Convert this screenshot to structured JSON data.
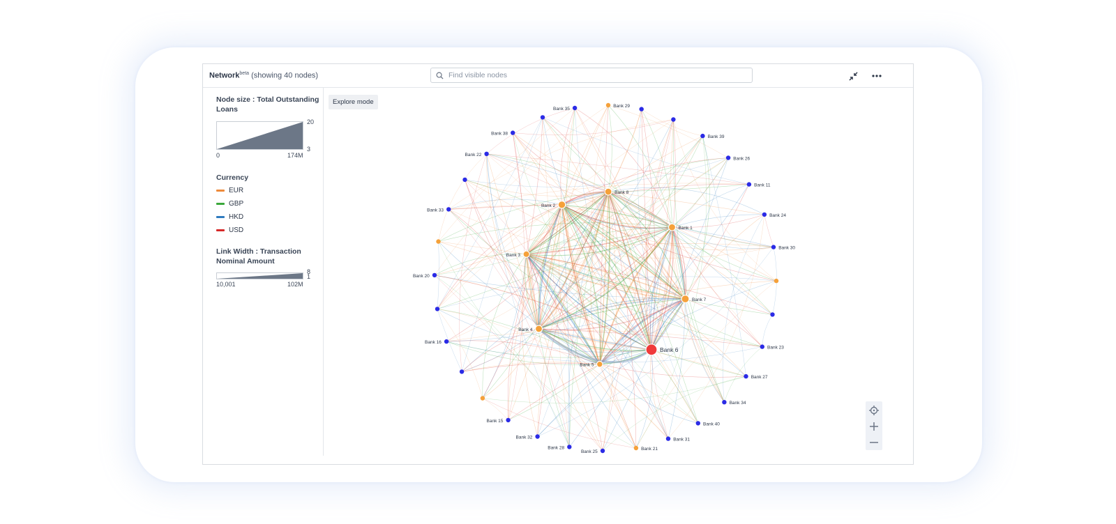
{
  "header": {
    "title": "Network",
    "beta": "beta",
    "subtitle": "(showing 40 nodes)",
    "search_placeholder": "Find visible nodes"
  },
  "sidebar": {
    "node_size_title": "Node size : Total Outstanding Loans",
    "node_size_min": "0",
    "node_size_max": "174M",
    "node_size_low": "3",
    "node_size_high": "20",
    "currency_title": "Currency",
    "currencies": [
      {
        "label": "EUR",
        "color": "#ee8a3a"
      },
      {
        "label": "GBP",
        "color": "#3aa83a"
      },
      {
        "label": "HKD",
        "color": "#2f7bbf"
      },
      {
        "label": "USD",
        "color": "#d62828"
      }
    ],
    "link_width_title": "Link Width : Transaction Nominal Amount",
    "link_min": "10,001",
    "link_max": "102M",
    "link_low": "1",
    "link_high": "8"
  },
  "explore_label": "Explore mode",
  "icons": {
    "search": "search-icon",
    "collapse": "collapse-arrows-icon",
    "more": "more-horizontal-icon",
    "center": "crosshair-icon",
    "zoom_in": "plus-icon",
    "zoom_out": "minus-icon"
  },
  "colors": {
    "node_blue": "#2b2be6",
    "node_orange": "#f5a13a",
    "node_red": "#f03a3a"
  },
  "network": {
    "node_count": 40,
    "outer_nodes": [
      {
        "label": "Bank 35",
        "color": "blue"
      },
      {
        "label": "Bank 29",
        "color": "orange"
      },
      {
        "label": "",
        "color": "blue"
      },
      {
        "label": "",
        "color": "blue"
      },
      {
        "label": "Bank 39",
        "color": "blue"
      },
      {
        "label": "Bank 26",
        "color": "blue"
      },
      {
        "label": "Bank 11",
        "color": "blue"
      },
      {
        "label": "Bank 24",
        "color": "blue"
      },
      {
        "label": "Bank 30",
        "color": "blue"
      },
      {
        "label": "",
        "color": "orange"
      },
      {
        "label": "",
        "color": "blue"
      },
      {
        "label": "Bank 23",
        "color": "blue"
      },
      {
        "label": "Bank 27",
        "color": "blue"
      },
      {
        "label": "Bank 34",
        "color": "blue"
      },
      {
        "label": "Bank 40",
        "color": "blue"
      },
      {
        "label": "Bank 31",
        "color": "blue"
      },
      {
        "label": "Bank 21",
        "color": "orange"
      },
      {
        "label": "Bank 25",
        "color": "blue"
      },
      {
        "label": "Bank 28",
        "color": "blue"
      },
      {
        "label": "Bank 32",
        "color": "blue"
      },
      {
        "label": "Bank 15",
        "color": "blue"
      },
      {
        "label": "",
        "color": "orange"
      },
      {
        "label": "",
        "color": "blue"
      },
      {
        "label": "Bank 16",
        "color": "blue"
      },
      {
        "label": "",
        "color": "blue"
      },
      {
        "label": "Bank 20",
        "color": "blue"
      },
      {
        "label": "",
        "color": "orange"
      },
      {
        "label": "Bank 33",
        "color": "blue"
      },
      {
        "label": "",
        "color": "blue"
      },
      {
        "label": "Bank 22",
        "color": "blue"
      },
      {
        "label": "Bank 38",
        "color": "blue"
      },
      {
        "label": "",
        "color": "blue"
      }
    ],
    "inner_nodes": [
      {
        "label": "Bank 8",
        "color": "orange"
      },
      {
        "label": "Bank 1",
        "color": "orange"
      },
      {
        "label": "Bank 7",
        "color": "orange"
      },
      {
        "label": "Bank 6",
        "color": "red"
      },
      {
        "label": "Bank 5",
        "color": "orange"
      },
      {
        "label": "Bank 4",
        "color": "orange"
      },
      {
        "label": "Bank 3",
        "color": "orange"
      },
      {
        "label": "Bank 2",
        "color": "orange"
      }
    ]
  }
}
